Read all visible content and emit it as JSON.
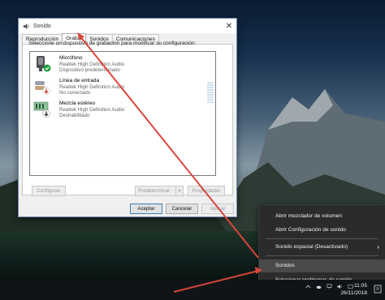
{
  "dialog": {
    "title": "Sonido",
    "tabs": [
      "Reproducción",
      "Grabar",
      "Sonidos",
      "Comunicaciones"
    ],
    "active_tab": "Grabar",
    "instruction": "Seleccione un dispositivo de grabación para modificar su configuración:",
    "devices": [
      {
        "name": "Micrófono",
        "driver": "Realtek High Definition Audio",
        "status": "Dispositivo predeterminado",
        "icon": "microphone-icon"
      },
      {
        "name": "Línea de entrada",
        "driver": "Realtek High Definition Audio",
        "status": "No conectado",
        "icon": "line-in-icon"
      },
      {
        "name": "Mezcla estéreo",
        "driver": "Realtek High Definition Audio",
        "status": "Deshabilitado",
        "icon": "stereo-mix-icon"
      }
    ],
    "buttons": {
      "configure": "Configurar",
      "default": "Predeterminar",
      "properties": "Propiedades",
      "accept": "Aceptar",
      "cancel": "Cancelar",
      "apply": "Aplicar"
    },
    "close_glyph": "✕",
    "dropdown_glyph": "▾"
  },
  "context_menu": {
    "items": [
      {
        "label": "Abrir mezclador de volumen"
      },
      {
        "label": "Abrir Configuración de sonido"
      },
      {
        "label": "Sonido espacial (Desactivado)"
      },
      {
        "label": "Sonidos"
      },
      {
        "label": "Solucionar problemas de sonido"
      }
    ],
    "highlighted": "Sonidos",
    "submenu_glyph": "›"
  },
  "taskbar": {
    "time": "11:05",
    "date": "26/11/2018"
  },
  "colors": {
    "annotation_arrow": "#d9453c",
    "menu_bg": "#2b2b2b",
    "default_check": "#1e9e3a",
    "disconnected_badge": "#c83a2a"
  }
}
